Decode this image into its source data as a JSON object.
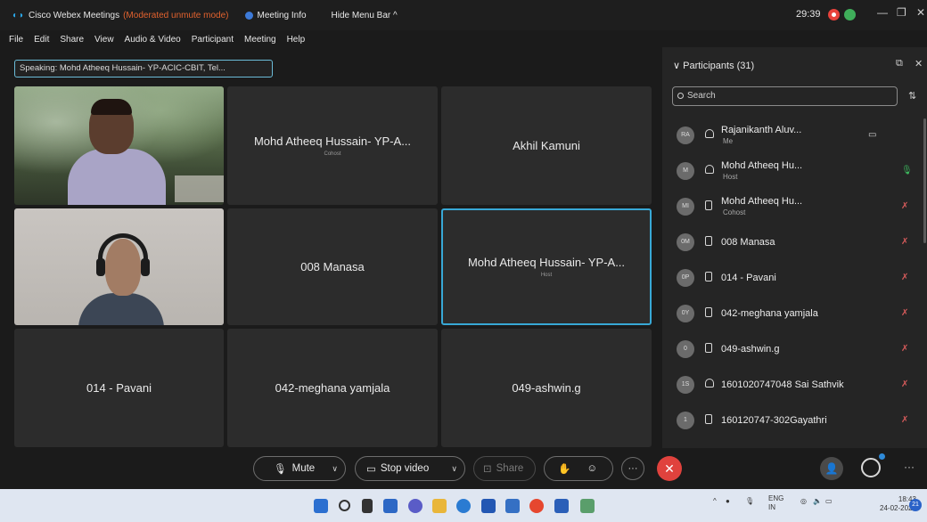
{
  "titlebar": {
    "app_name": "Cisco Webex Meetings",
    "mode": "(Moderated unmute mode)",
    "meeting_info": "Meeting Info",
    "hide_menu": "Hide Menu Bar ^",
    "timer": "29:39"
  },
  "menu": [
    "File",
    "Edit",
    "Share",
    "View",
    "Audio & Video",
    "Participant",
    "Meeting",
    "Help"
  ],
  "speaking": "Speaking: Mohd Atheeq Hussain- YP-ACIC-CBIT, Tel...",
  "tiles": [
    {
      "name": "",
      "role": ""
    },
    {
      "name": "Mohd Atheeq Hussain- YP-A...",
      "role": "Cohost"
    },
    {
      "name": "Akhil Kamuni",
      "role": ""
    },
    {
      "name": "",
      "role": ""
    },
    {
      "name": "008 Manasa",
      "role": ""
    },
    {
      "name": "Mohd Atheeq Hussain- YP-A...",
      "role": "Host"
    },
    {
      "name": "014 - Pavani",
      "role": ""
    },
    {
      "name": "042-meghana yamjala",
      "role": ""
    },
    {
      "name": "049-ashwin.g",
      "role": ""
    }
  ],
  "participants": {
    "title": "Participants (31)",
    "search_placeholder": "Search",
    "list": [
      {
        "initials": "RA",
        "name": "Rajanikanth Aluv...",
        "sub": "Me"
      },
      {
        "initials": "M",
        "name": "Mohd Atheeq Hu...",
        "sub": "Host"
      },
      {
        "initials": "MI",
        "name": "Mohd Atheeq Hu...",
        "sub": "Cohost"
      },
      {
        "initials": "0M",
        "name": "008 Manasa",
        "sub": ""
      },
      {
        "initials": "0P",
        "name": "014 - Pavani",
        "sub": ""
      },
      {
        "initials": "0Y",
        "name": "042-meghana yamjala",
        "sub": ""
      },
      {
        "initials": "0",
        "name": "049-ashwin.g",
        "sub": ""
      },
      {
        "initials": "1S",
        "name": "1601020747048 Sai Sathvik",
        "sub": ""
      },
      {
        "initials": "1",
        "name": "160120747-302Gayathri",
        "sub": ""
      }
    ]
  },
  "controls": {
    "mute": "Mute",
    "stop_video": "Stop video",
    "share": "Share"
  },
  "taskbar": {
    "lang": "ENG",
    "region": "IN",
    "time": "18:43",
    "date": "24-02-2022",
    "badge": "21"
  }
}
